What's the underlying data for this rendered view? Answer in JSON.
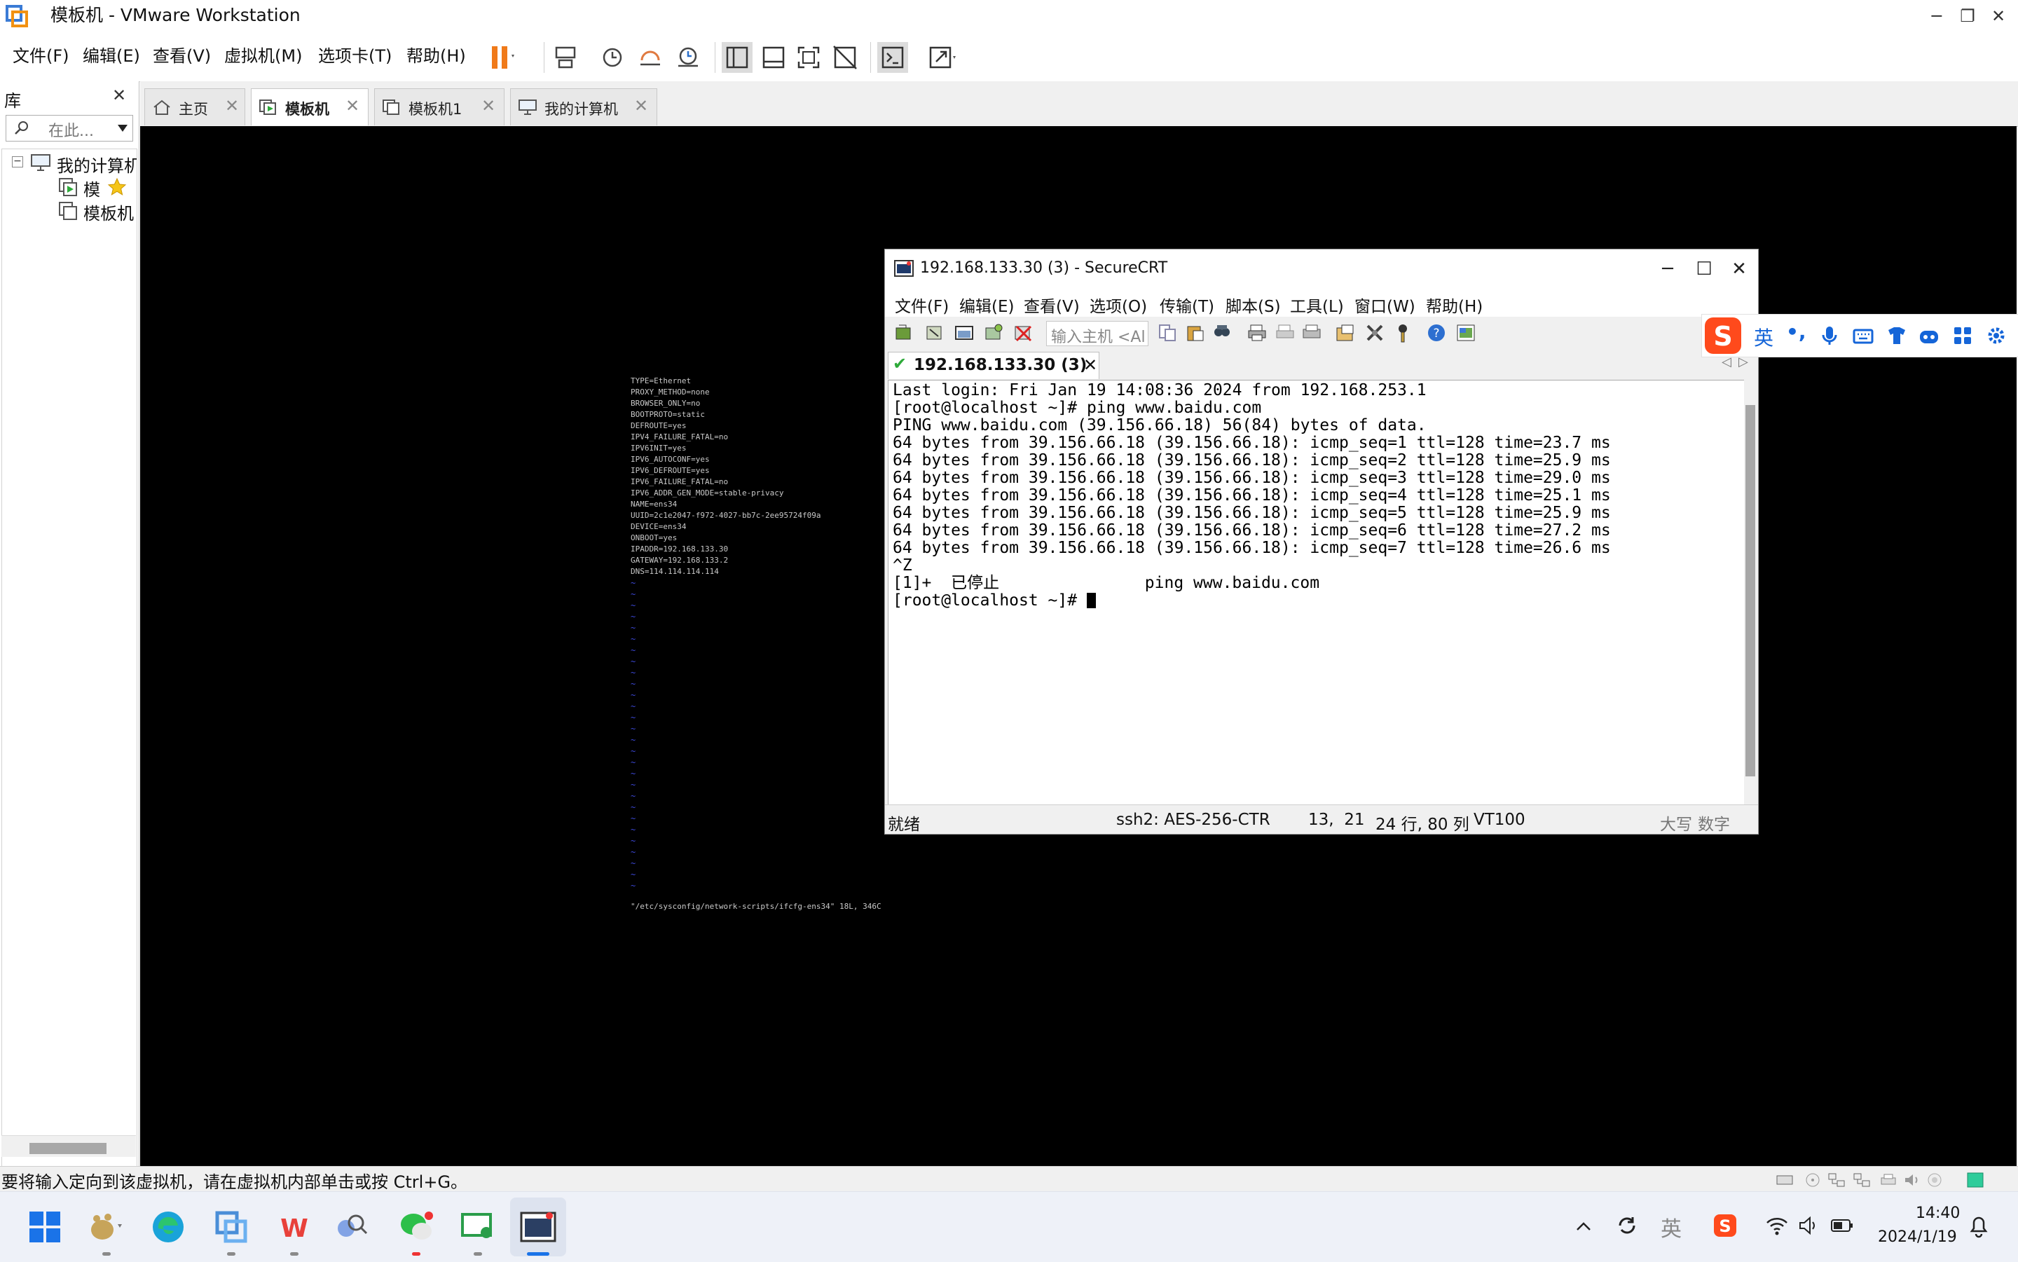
{
  "window": {
    "title": "模板机 - VMware Workstation",
    "controls": {
      "minimize": "─",
      "restore": "❐",
      "close": "✕"
    }
  },
  "menubar": {
    "items": [
      "文件(F)",
      "编辑(E)",
      "查看(V)",
      "虚拟机(M)",
      "选项卡(T)",
      "帮助(H)"
    ]
  },
  "library": {
    "title": "库",
    "close": "✕",
    "search_placeholder": "在此...",
    "tree": {
      "root": "我的计算机",
      "children": [
        "模",
        "模板机"
      ]
    }
  },
  "tabs": [
    {
      "label": "主页",
      "close": "✕"
    },
    {
      "label": "模板机",
      "close": "✕"
    },
    {
      "label": "模板机1",
      "close": "✕"
    },
    {
      "label": "我的计算机",
      "close": "✕"
    }
  ],
  "vm_console": {
    "lines": [
      "TYPE=Ethernet",
      "PROXY_METHOD=none",
      "BROWSER_ONLY=no",
      "BOOTPROTO=static",
      "DEFROUTE=yes",
      "IPV4_FAILURE_FATAL=no",
      "IPV6INIT=yes",
      "IPV6_AUTOCONF=yes",
      "IPV6_DEFROUTE=yes",
      "IPV6_FAILURE_FATAL=no",
      "IPV6_ADDR_GEN_MODE=stable-privacy",
      "NAME=ens34",
      "UUID=2c1e2047-f972-4027-bb7c-2ee95724f09a",
      "DEVICE=ens34",
      "ONBOOT=yes",
      "IPADDR=192.168.133.30",
      "GATEWAY=192.168.133.2",
      "DNS=114.114.114.114"
    ],
    "tilde": "~",
    "file_status": "\"/etc/sysconfig/network-scripts/ifcfg-ens34\" 18L, 346C"
  },
  "securecrt": {
    "title": "192.168.133.30 (3) - SecureCRT",
    "controls": {
      "minimize": "─",
      "maximize": "☐",
      "close": "✕"
    },
    "menu": [
      "文件(F)",
      "编辑(E)",
      "查看(V)",
      "选项(O)",
      "传输(T)",
      "脚本(S)",
      "工具(L)",
      "窗口(W)",
      "帮助(H)"
    ],
    "host_placeholder": "输入主机 <Al",
    "tab": {
      "label": "192.168.133.30 (3)",
      "close": "✕",
      "check": "✔"
    },
    "tab_nav": {
      "prev": "◁",
      "next": "▷"
    },
    "terminal_lines": [
      "Last login: Fri Jan 19 14:08:36 2024 from 192.168.253.1",
      "[root@localhost ~]# ping www.baidu.com",
      "PING www.baidu.com (39.156.66.18) 56(84) bytes of data.",
      "64 bytes from 39.156.66.18 (39.156.66.18): icmp_seq=1 ttl=128 time=23.7 ms",
      "64 bytes from 39.156.66.18 (39.156.66.18): icmp_seq=2 ttl=128 time=25.9 ms",
      "64 bytes from 39.156.66.18 (39.156.66.18): icmp_seq=3 ttl=128 time=29.0 ms",
      "64 bytes from 39.156.66.18 (39.156.66.18): icmp_seq=4 ttl=128 time=25.1 ms",
      "64 bytes from 39.156.66.18 (39.156.66.18): icmp_seq=5 ttl=128 time=25.9 ms",
      "64 bytes from 39.156.66.18 (39.156.66.18): icmp_seq=6 ttl=128 time=27.2 ms",
      "64 bytes from 39.156.66.18 (39.156.66.18): icmp_seq=7 ttl=128 time=26.6 ms",
      "^Z",
      "[1]+  已停止               ping www.baidu.com",
      "[root@localhost ~]# "
    ],
    "status": {
      "ready": "就绪",
      "cipher": "ssh2: AES-256-CTR",
      "cursor_pos": "13,  21",
      "size": "24 行, 80 列",
      "terminal": "VT100",
      "caps": "大写",
      "num": "数字"
    }
  },
  "ime": {
    "mode": "英",
    "punct": "•,"
  },
  "statusbar": {
    "message": "要将输入定向到该虚拟机，请在虚拟机内部单击或按 Ctrl+G。"
  },
  "taskbar": {
    "time": "14:40",
    "date": "2024/1/19",
    "ime_label": "英"
  },
  "colors": {
    "vm_background": "#000000",
    "vim_tilde": "#3c48d8",
    "pause_orange": "#f07a1a",
    "sogou_red": "#ff4a1c",
    "ime_blue": "#1565d8",
    "windows_blue": "#1a73e8"
  }
}
